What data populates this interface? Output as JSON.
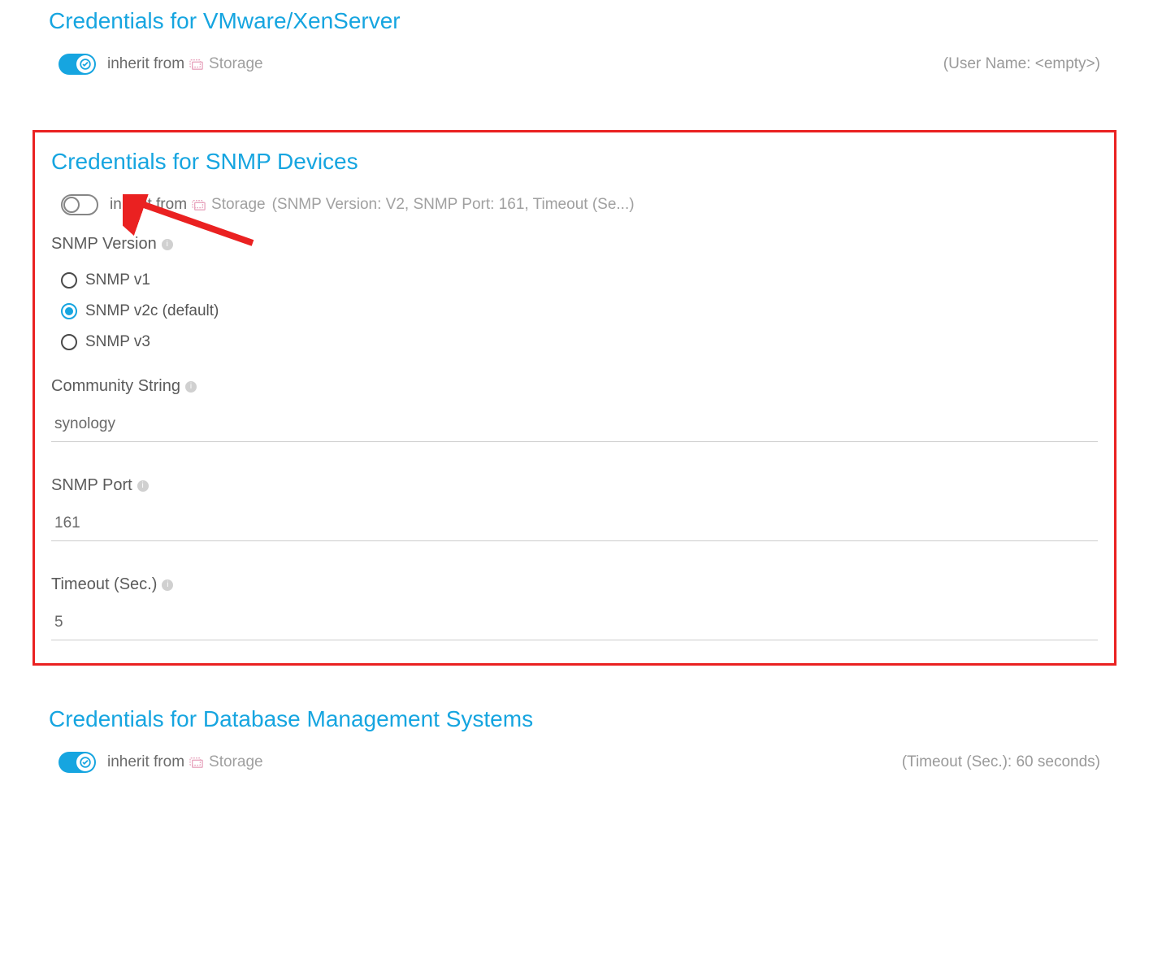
{
  "vmware": {
    "title": "Credentials for VMware/XenServer",
    "inherit_label": "inherit from",
    "inherit_source": "Storage",
    "summary": "(User Name: <empty>)"
  },
  "snmp": {
    "title": "Credentials for SNMP Devices",
    "inherit_label": "inherit from",
    "inherit_source": "Storage",
    "inherit_summary": "(SNMP Version: V2, SNMP Port: 161, Timeout (Se...)",
    "version_label": "SNMP Version",
    "options": {
      "v1": "SNMP v1",
      "v2c": "SNMP v2c (default)",
      "v3": "SNMP v3"
    },
    "community_label": "Community String",
    "community_value": "synology",
    "port_label": "SNMP Port",
    "port_value": "161",
    "timeout_label": "Timeout (Sec.)",
    "timeout_value": "5"
  },
  "dbms": {
    "title": "Credentials for Database Management Systems",
    "inherit_label": "inherit from",
    "inherit_source": "Storage",
    "summary": "(Timeout (Sec.): 60 seconds)"
  }
}
